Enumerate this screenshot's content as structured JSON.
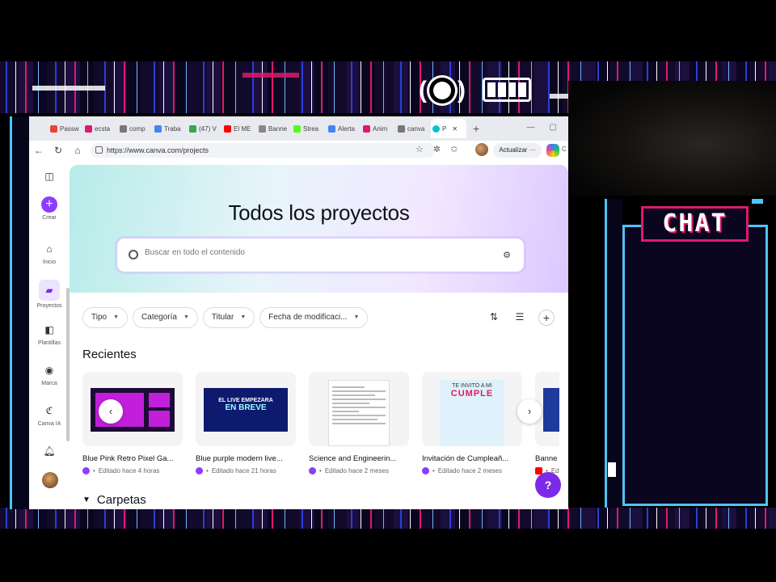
{
  "browser": {
    "tabs": [
      {
        "label": "Passw",
        "color": "#ea4335"
      },
      {
        "label": "ecsta",
        "color": "#e0196b"
      },
      {
        "label": "comp",
        "color": "#777777"
      },
      {
        "label": "Traba",
        "color": "#4285f4"
      },
      {
        "label": "(47) V",
        "color": "#34a853"
      },
      {
        "label": "El ME",
        "color": "#ff0000"
      },
      {
        "label": "Banne",
        "color": "#888888"
      },
      {
        "label": "Strea",
        "color": "#53fc18"
      },
      {
        "label": "Alerta",
        "color": "#4285f4"
      },
      {
        "label": "Anim",
        "color": "#e0196b"
      },
      {
        "label": "canva",
        "color": "#777777"
      },
      {
        "label": "P",
        "color": "#00c4cc"
      }
    ],
    "url": "https://www.canva.com/projects",
    "update_label": "Actualizar",
    "copilot_label": "C"
  },
  "sidebar": {
    "items": [
      {
        "label": "Crear",
        "icon": "plus-icon"
      },
      {
        "label": "Inicio",
        "icon": "home-icon"
      },
      {
        "label": "Proyectos",
        "icon": "folder-icon"
      },
      {
        "label": "Plantillas",
        "icon": "templates-icon"
      },
      {
        "label": "Marca",
        "icon": "brand-icon"
      },
      {
        "label": "Canva IA",
        "icon": "ai-icon"
      }
    ]
  },
  "main": {
    "title": "Todos los proyectos",
    "search_placeholder": "Buscar en todo el contenido",
    "filters": [
      "Tipo",
      "Categoría",
      "Titular",
      "Fecha de modificaci..."
    ],
    "recent_title": "Recientes",
    "folders_title": "Carpetas",
    "help_label": "?",
    "recent": [
      {
        "title": "Blue Pink Retro Pixel Ga...",
        "meta": "Editado hace 4 horas"
      },
      {
        "title": "Blue purple modern live...",
        "meta": "Editado hace 21 horas",
        "thumb_text": "EL LIVE EMPEZARA",
        "thumb_sub": "EN BREVE"
      },
      {
        "title": "Science and Engineerin...",
        "meta": "Editado hace 2 meses"
      },
      {
        "title": "Invitación de Cumpleañ...",
        "meta": "Editado hace 2 meses",
        "thumb_text": "TE INVITO A MI",
        "thumb_sub": "CUMPLE"
      },
      {
        "title": "Banne",
        "meta": "Ed"
      }
    ]
  },
  "overlay": {
    "chat_title": "CHAT",
    "accent_pink": "#e0196b",
    "accent_cyan": "#4fc3f7"
  }
}
